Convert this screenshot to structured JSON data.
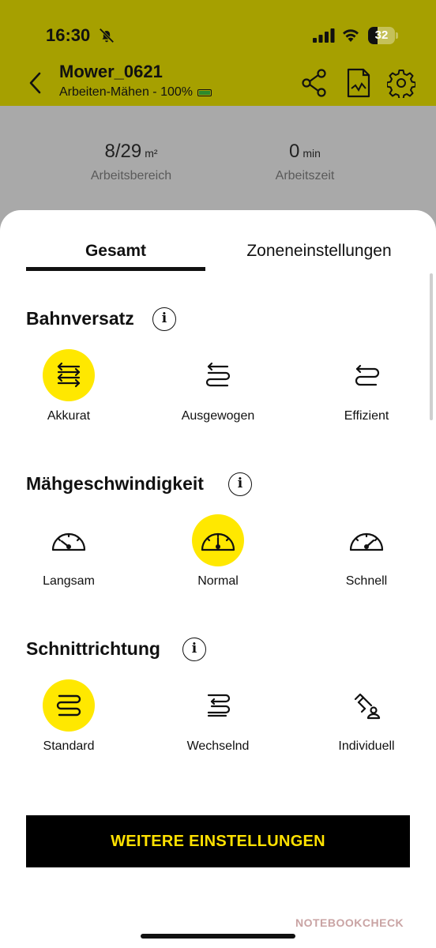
{
  "status_bar": {
    "time": "16:30",
    "battery": "32"
  },
  "header": {
    "title": "Mower_0621",
    "subtitle": "Arbeiten-Mähen - 100%"
  },
  "stats": [
    {
      "value": "8/29",
      "unit": "m²",
      "label": "Arbeitsbereich"
    },
    {
      "value": "0",
      "unit": "min",
      "label": "Arbeitszeit"
    }
  ],
  "tabs": [
    {
      "label": "Gesamt",
      "active": true
    },
    {
      "label": "Zoneneinstellungen",
      "active": false
    }
  ],
  "sections": {
    "bahnversatz": {
      "title": "Bahnversatz",
      "options": [
        {
          "label": "Akkurat",
          "selected": true,
          "icon": "path-accurate-icon"
        },
        {
          "label": "Ausgewogen",
          "selected": false,
          "icon": "path-balanced-icon"
        },
        {
          "label": "Effizient",
          "selected": false,
          "icon": "path-efficient-icon"
        }
      ]
    },
    "speed": {
      "title": "Mähgeschwindigkeit",
      "options": [
        {
          "label": "Langsam",
          "selected": false,
          "icon": "gauge-slow-icon"
        },
        {
          "label": "Normal",
          "selected": true,
          "icon": "gauge-normal-icon"
        },
        {
          "label": "Schnell",
          "selected": false,
          "icon": "gauge-fast-icon"
        }
      ]
    },
    "direction": {
      "title": "Schnittrichtung",
      "options": [
        {
          "label": "Standard",
          "selected": true,
          "icon": "direction-standard-icon"
        },
        {
          "label": "Wechselnd",
          "selected": false,
          "icon": "direction-alternating-icon"
        },
        {
          "label": "Individuell",
          "selected": false,
          "icon": "direction-custom-icon"
        }
      ]
    }
  },
  "more_button": "WEITERE EINSTELLUNGEN",
  "watermark": "NOTEBOOKCHECK",
  "colors": {
    "accent": "#ffe800",
    "header_bg": "#a6a000",
    "overlay_bg": "#a9a9a9",
    "button_bg": "#000000",
    "button_text": "#ffe100"
  }
}
